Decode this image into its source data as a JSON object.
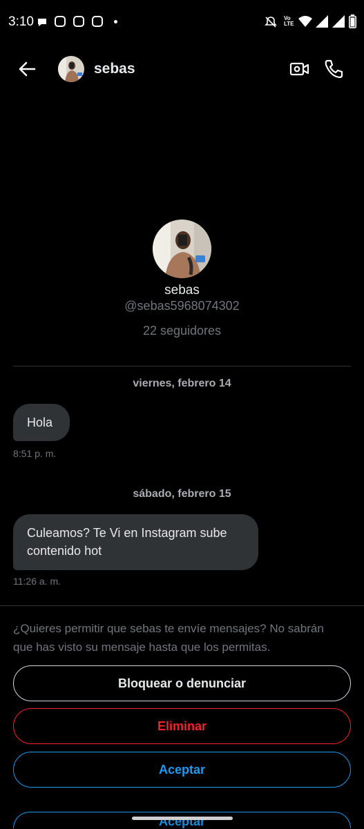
{
  "status_bar": {
    "time": "3:10",
    "lte": "Vo LTE"
  },
  "header": {
    "name": "sebas",
    "icons": [
      "back-arrow-icon",
      "video-call-icon",
      "phone-icon"
    ]
  },
  "profile": {
    "name": "sebas",
    "handle": "@sebas5968074302",
    "followers": "22 seguidores"
  },
  "conversation": [
    {
      "date": "viernes, febrero 14",
      "message": "Hola",
      "time": "8:51 p. m."
    },
    {
      "date": "sábado, febrero 15",
      "message": "Culeamos? Te Vi en Instagram sube contenido hot",
      "time": "11:26 a. m."
    }
  ],
  "request": {
    "text": "¿Quieres permitir que sebas te envíe mensajes? No sabrán que has visto su mensaje hasta que los permitas.",
    "block_label": "Bloquear o denunciar",
    "delete_label": "Eliminar",
    "accept_label": "Aceptar",
    "ghost_label": "Aceptar"
  },
  "colors": {
    "background": "#000000",
    "accent_blue": "#1d9bf0",
    "danger_red": "#f4212e",
    "bubble": "#2f3336"
  }
}
